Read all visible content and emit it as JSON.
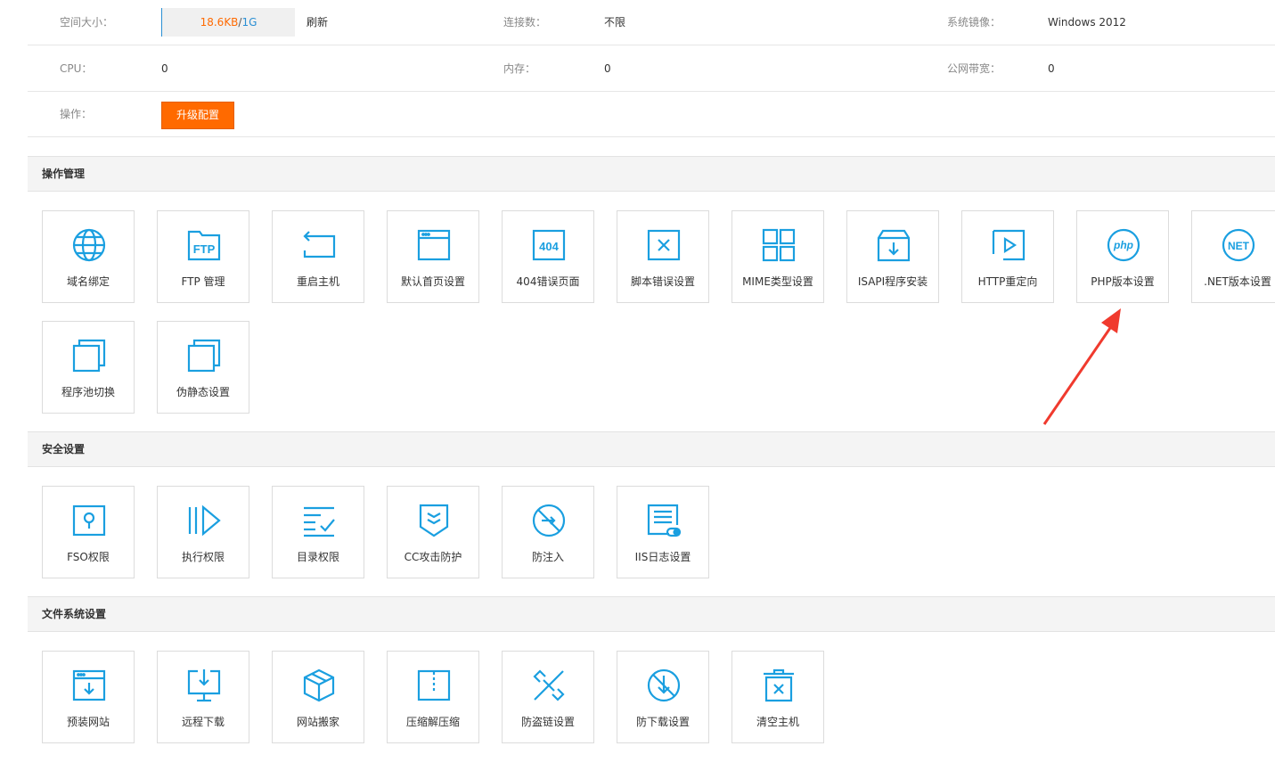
{
  "info": {
    "space_label": "空间大小：",
    "space_used": "18.6KB",
    "space_sep": "/",
    "space_total": "1G",
    "refresh_label": "刷新",
    "connections_label": "连接数：",
    "connections_value": "不限",
    "os_image_label": "系统镜像：",
    "os_image_value": "Windows 2012",
    "cpu_label": "CPU：",
    "cpu_value": "0",
    "memory_label": "内存：",
    "memory_value": "0",
    "bandwidth_label": "公网带宽：",
    "bandwidth_value": "0",
    "operation_label": "操作：",
    "upgrade_label": "升级配置"
  },
  "sections": {
    "ops": {
      "title": "操作管理",
      "items": [
        {
          "label": "域名绑定",
          "icon": "globe-icon"
        },
        {
          "label": "FTP 管理",
          "icon": "ftp-folder-icon"
        },
        {
          "label": "重启主机",
          "icon": "restart-icon"
        },
        {
          "label": "默认首页设置",
          "icon": "browser-window-icon"
        },
        {
          "label": "404错误页面",
          "icon": "error-404-icon"
        },
        {
          "label": "脚本错误设置",
          "icon": "script-error-icon"
        },
        {
          "label": "MIME类型设置",
          "icon": "grid-icon"
        },
        {
          "label": "ISAPI程序安装",
          "icon": "install-box-icon"
        },
        {
          "label": "HTTP重定向",
          "icon": "redirect-play-icon"
        },
        {
          "label": "PHP版本设置",
          "icon": "php-icon"
        },
        {
          "label": ".NET版本设置",
          "icon": "dotnet-icon"
        },
        {
          "label": "程序池切换",
          "icon": "app-pool-icon"
        },
        {
          "label": "伪静态设置",
          "icon": "rewrite-icon"
        }
      ]
    },
    "security": {
      "title": "安全设置",
      "items": [
        {
          "label": "FSO权限",
          "icon": "lock-icon"
        },
        {
          "label": "执行权限",
          "icon": "execute-icon"
        },
        {
          "label": "目录权限",
          "icon": "directory-check-icon"
        },
        {
          "label": "CC攻击防护",
          "icon": "shield-icon"
        },
        {
          "label": "防注入",
          "icon": "anti-injection-icon"
        },
        {
          "label": "IIS日志设置",
          "icon": "log-toggle-icon"
        }
      ]
    },
    "files": {
      "title": "文件系统设置",
      "items": [
        {
          "label": "预装网站",
          "icon": "preinstall-icon"
        },
        {
          "label": "远程下载",
          "icon": "remote-download-icon"
        },
        {
          "label": "网站搬家",
          "icon": "package-icon"
        },
        {
          "label": "压缩解压缩",
          "icon": "zip-icon"
        },
        {
          "label": "防盗链设置",
          "icon": "hotlink-icon"
        },
        {
          "label": "防下载设置",
          "icon": "no-download-icon"
        },
        {
          "label": "清空主机",
          "icon": "trash-icon"
        }
      ]
    }
  },
  "colors": {
    "accent": "#1a9fe0",
    "upgrade": "#ff6a00",
    "annotation_arrow": "#f03a2e"
  }
}
